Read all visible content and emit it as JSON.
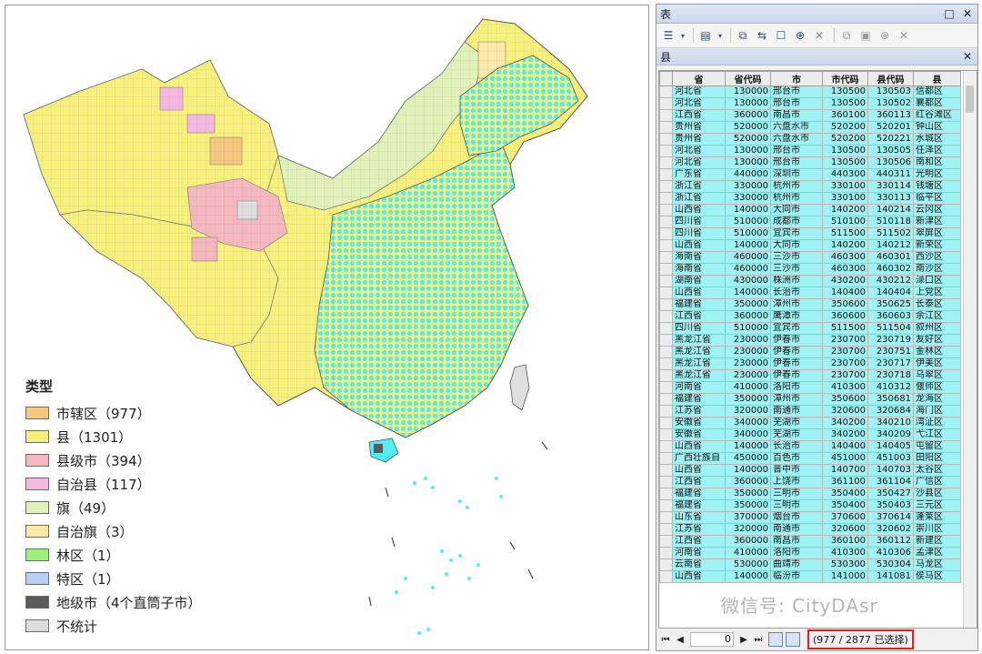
{
  "legend": {
    "title": "类型",
    "items": [
      {
        "label": "市辖区（977）",
        "color": "#f7c77e"
      },
      {
        "label": "县（1301）",
        "color": "#f7f07a"
      },
      {
        "label": "县级市（394）",
        "color": "#f5b8c0"
      },
      {
        "label": "自治县（117）",
        "color": "#f5b8e0"
      },
      {
        "label": "旗（49）",
        "color": "#e0f2b8"
      },
      {
        "label": "自治旗（3）",
        "color": "#fde9a8"
      },
      {
        "label": "林区（1）",
        "color": "#9ef07a"
      },
      {
        "label": "特区（1）",
        "color": "#b8cef5"
      },
      {
        "label": "地级市（4个直筒子市）",
        "color": "#5a5a5a"
      },
      {
        "label": "不统计",
        "color": "#dedede"
      }
    ]
  },
  "table_window": {
    "title": "表",
    "layer_tab": "县",
    "columns": [
      "省",
      "省代码",
      "市",
      "市代码",
      "县代码",
      "县"
    ],
    "rows": [
      [
        "河北省",
        "130000",
        "邢台市",
        "130500",
        "130503",
        "信都区"
      ],
      [
        "河北省",
        "130000",
        "邢台市",
        "130500",
        "130502",
        "襄都区"
      ],
      [
        "江西省",
        "360000",
        "南昌市",
        "360100",
        "360113",
        "红谷滩区"
      ],
      [
        "贵州省",
        "520000",
        "六盘水市",
        "520200",
        "520201",
        "钟山区"
      ],
      [
        "贵州省",
        "520000",
        "六盘水市",
        "520200",
        "520221",
        "水城区"
      ],
      [
        "河北省",
        "130000",
        "邢台市",
        "130500",
        "130505",
        "任泽区"
      ],
      [
        "河北省",
        "130000",
        "邢台市",
        "130500",
        "130506",
        "南和区"
      ],
      [
        "广东省",
        "440000",
        "深圳市",
        "440300",
        "440311",
        "光明区"
      ],
      [
        "浙江省",
        "330000",
        "杭州市",
        "330100",
        "330114",
        "钱塘区"
      ],
      [
        "浙江省",
        "330000",
        "杭州市",
        "330100",
        "330113",
        "临平区"
      ],
      [
        "山西省",
        "140000",
        "大同市",
        "140200",
        "140214",
        "云冈区"
      ],
      [
        "四川省",
        "510000",
        "成都市",
        "510100",
        "510118",
        "新津区"
      ],
      [
        "四川省",
        "510000",
        "宜宾市",
        "511500",
        "511502",
        "翠屏区"
      ],
      [
        "山西省",
        "140000",
        "大同市",
        "140200",
        "140212",
        "新荣区"
      ],
      [
        "海南省",
        "460000",
        "三沙市",
        "460300",
        "460301",
        "西沙区"
      ],
      [
        "海南省",
        "460000",
        "三沙市",
        "460300",
        "460302",
        "南沙区"
      ],
      [
        "湖南省",
        "430000",
        "株洲市",
        "430200",
        "430212",
        "渌口区"
      ],
      [
        "山西省",
        "140000",
        "长治市",
        "140400",
        "140404",
        "上党区"
      ],
      [
        "福建省",
        "350000",
        "漳州市",
        "350600",
        "350625",
        "长泰区"
      ],
      [
        "江西省",
        "360000",
        "鹰潭市",
        "360600",
        "360603",
        "余江区"
      ],
      [
        "四川省",
        "510000",
        "宜宾市",
        "511500",
        "511504",
        "叙州区"
      ],
      [
        "黑龙江省",
        "230000",
        "伊春市",
        "230700",
        "230719",
        "友好区"
      ],
      [
        "黑龙江省",
        "230000",
        "伊春市",
        "230700",
        "230751",
        "金林区"
      ],
      [
        "黑龙江省",
        "230000",
        "伊春市",
        "230700",
        "230717",
        "伊美区"
      ],
      [
        "黑龙江省",
        "230000",
        "伊春市",
        "230700",
        "230718",
        "乌翠区"
      ],
      [
        "河南省",
        "410000",
        "洛阳市",
        "410300",
        "410312",
        "偃师区"
      ],
      [
        "福建省",
        "350000",
        "漳州市",
        "350600",
        "350681",
        "龙海区"
      ],
      [
        "江苏省",
        "320000",
        "南通市",
        "320600",
        "320684",
        "海门区"
      ],
      [
        "安徽省",
        "340000",
        "芜湖市",
        "340200",
        "340210",
        "湾沚区"
      ],
      [
        "安徽省",
        "340000",
        "芜湖市",
        "340200",
        "340209",
        "弋江区"
      ],
      [
        "山西省",
        "140000",
        "长治市",
        "140400",
        "140405",
        "屯留区"
      ],
      [
        "广西壮族自",
        "450000",
        "百色市",
        "451000",
        "451003",
        "田阳区"
      ],
      [
        "山西省",
        "140000",
        "晋中市",
        "140700",
        "140703",
        "太谷区"
      ],
      [
        "江西省",
        "360000",
        "上饶市",
        "361100",
        "361104",
        "广信区"
      ],
      [
        "福建省",
        "350000",
        "三明市",
        "350400",
        "350427",
        "沙县区"
      ],
      [
        "福建省",
        "350000",
        "三明市",
        "350400",
        "350403",
        "三元区"
      ],
      [
        "山东省",
        "370000",
        "烟台市",
        "370600",
        "370614",
        "蓬莱区"
      ],
      [
        "江苏省",
        "320000",
        "南通市",
        "320600",
        "320602",
        "崇川区"
      ],
      [
        "江西省",
        "360000",
        "南昌市",
        "360100",
        "360112",
        "新建区"
      ],
      [
        "河南省",
        "410000",
        "洛阳市",
        "410300",
        "410306",
        "孟津区"
      ],
      [
        "云南省",
        "530000",
        "曲靖市",
        "530300",
        "530304",
        "马龙区"
      ],
      [
        "山西省",
        "140000",
        "临汾市",
        "141000",
        "141081",
        "侯马区"
      ]
    ],
    "record_index": "0",
    "selection_status": "(977 / 2877 已选择)"
  },
  "watermark": "微信号: CityDAsr"
}
